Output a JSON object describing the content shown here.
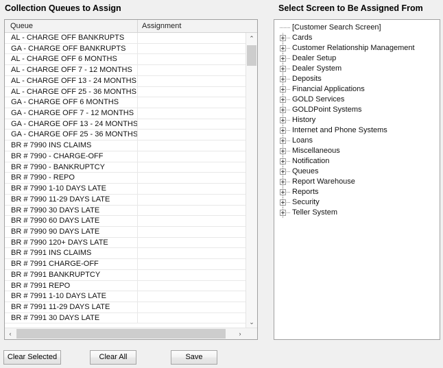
{
  "left_panel": {
    "title": "Collection Queues to Assign",
    "columns": [
      "Queue",
      "Assignment"
    ],
    "rows": [
      {
        "queue": "AL - CHARGE OFF BANKRUPTS",
        "assignment": ""
      },
      {
        "queue": "GA - CHARGE OFF BANKRUPTS",
        "assignment": ""
      },
      {
        "queue": "AL - CHARGE OFF 6 MONTHS",
        "assignment": ""
      },
      {
        "queue": "AL - CHARGE OFF 7 - 12 MONTHS",
        "assignment": ""
      },
      {
        "queue": "AL - CHARGE OFF 13 - 24 MONTHS",
        "assignment": ""
      },
      {
        "queue": "AL - CHARGE OFF 25 - 36 MONTHS",
        "assignment": ""
      },
      {
        "queue": "GA - CHARGE OFF 6 MONTHS",
        "assignment": ""
      },
      {
        "queue": "GA - CHARGE OFF 7 - 12 MONTHS",
        "assignment": ""
      },
      {
        "queue": "GA - CHARGE OFF 13 - 24 MONTHS",
        "assignment": ""
      },
      {
        "queue": "GA - CHARGE OFF 25 - 36 MONTHS",
        "assignment": ""
      },
      {
        "queue": "BR # 7990 INS CLAIMS",
        "assignment": ""
      },
      {
        "queue": "BR # 7990 - CHARGE-OFF",
        "assignment": ""
      },
      {
        "queue": "BR # 7990 - BANKRUPTCY",
        "assignment": ""
      },
      {
        "queue": "BR # 7990 - REPO",
        "assignment": ""
      },
      {
        "queue": "BR # 7990  1-10 DAYS LATE",
        "assignment": ""
      },
      {
        "queue": "BR # 7990 11-29 DAYS LATE",
        "assignment": ""
      },
      {
        "queue": "BR # 7990 30 DAYS LATE",
        "assignment": ""
      },
      {
        "queue": "BR # 7990 60 DAYS LATE",
        "assignment": ""
      },
      {
        "queue": "BR # 7990 90 DAYS LATE",
        "assignment": ""
      },
      {
        "queue": "BR # 7990 120+ DAYS LATE",
        "assignment": ""
      },
      {
        "queue": "BR # 7991 INS CLAIMS",
        "assignment": ""
      },
      {
        "queue": "BR # 7991 CHARGE-OFF",
        "assignment": ""
      },
      {
        "queue": "BR # 7991 BANKRUPTCY",
        "assignment": ""
      },
      {
        "queue": "BR # 7991  REPO",
        "assignment": ""
      },
      {
        "queue": "BR # 7991  1-10 DAYS LATE",
        "assignment": ""
      },
      {
        "queue": "BR # 7991  11-29 DAYS LATE",
        "assignment": ""
      },
      {
        "queue": "BR # 7991  30 DAYS LATE",
        "assignment": ""
      }
    ],
    "vscroll": {
      "up_glyph": "⌃",
      "down_glyph": "⌄"
    },
    "hscroll": {
      "left_glyph": "‹",
      "right_glyph": "›"
    }
  },
  "right_panel": {
    "title": "Select Screen to Be Assigned From",
    "tree_items": [
      {
        "label": "[Customer Search Screen]",
        "expandable": false
      },
      {
        "label": "Cards",
        "expandable": true
      },
      {
        "label": "Customer Relationship Management",
        "expandable": true
      },
      {
        "label": "Dealer Setup",
        "expandable": true
      },
      {
        "label": "Dealer System",
        "expandable": true
      },
      {
        "label": "Deposits",
        "expandable": true
      },
      {
        "label": "Financial Applications",
        "expandable": true
      },
      {
        "label": "GOLD Services",
        "expandable": true
      },
      {
        "label": "GOLDPoint Systems",
        "expandable": true
      },
      {
        "label": "History",
        "expandable": true
      },
      {
        "label": "Internet and Phone Systems",
        "expandable": true
      },
      {
        "label": "Loans",
        "expandable": true
      },
      {
        "label": "Miscellaneous",
        "expandable": true
      },
      {
        "label": "Notification",
        "expandable": true
      },
      {
        "label": "Queues",
        "expandable": true
      },
      {
        "label": "Report Warehouse",
        "expandable": true
      },
      {
        "label": "Reports",
        "expandable": true
      },
      {
        "label": "Security",
        "expandable": true
      },
      {
        "label": "Teller System",
        "expandable": true
      }
    ]
  },
  "buttons": {
    "clear_selected": "Clear Selected",
    "clear_all": "Clear All",
    "save": "Save"
  },
  "colors": {
    "window_background": "#f0f0f0",
    "field_background": "#ffffff",
    "border": "#a0a0a0",
    "grid_line": "#e8e8e8",
    "scroll_thumb": "#cdcdcd"
  }
}
